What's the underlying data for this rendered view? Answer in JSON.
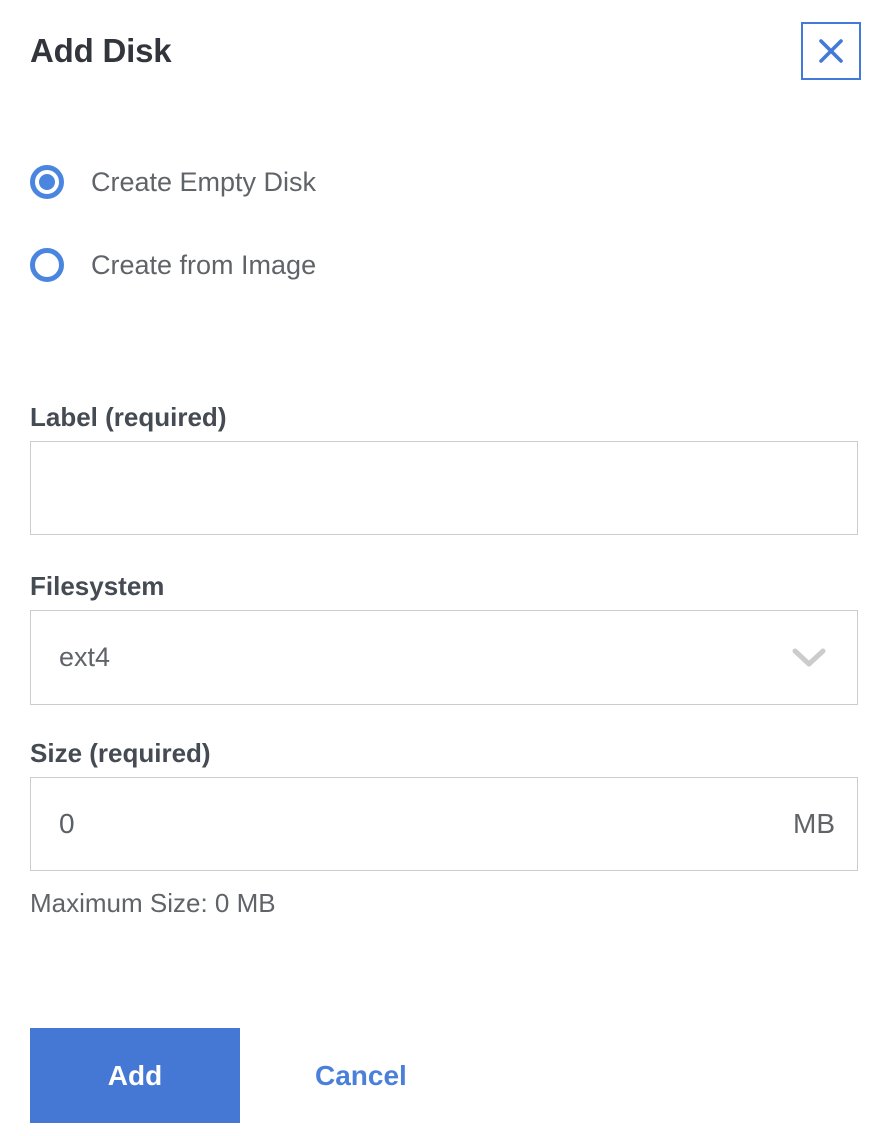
{
  "modal": {
    "title": "Add Disk"
  },
  "colors": {
    "accent_blue": "#4577d4",
    "radio_blue": "#4a86e0",
    "link_blue": "#4a80d9",
    "title_text": "#32363c",
    "body_gray": "#606469",
    "input_border": "#cccccc"
  },
  "icons": {
    "close": "close-icon",
    "chevron": "chevron-down-icon"
  },
  "radio_group": {
    "options": [
      {
        "label": "Create Empty Disk",
        "selected": true
      },
      {
        "label": "Create from Image",
        "selected": false
      }
    ]
  },
  "fields": {
    "label": {
      "label": "Label (required)",
      "value": "",
      "placeholder": ""
    },
    "filesystem": {
      "label": "Filesystem",
      "value": "ext4"
    },
    "size": {
      "label": "Size (required)",
      "value": "0",
      "unit": "MB",
      "helper": "Maximum Size: 0 MB"
    }
  },
  "actions": {
    "add_label": "Add",
    "cancel_label": "Cancel"
  }
}
